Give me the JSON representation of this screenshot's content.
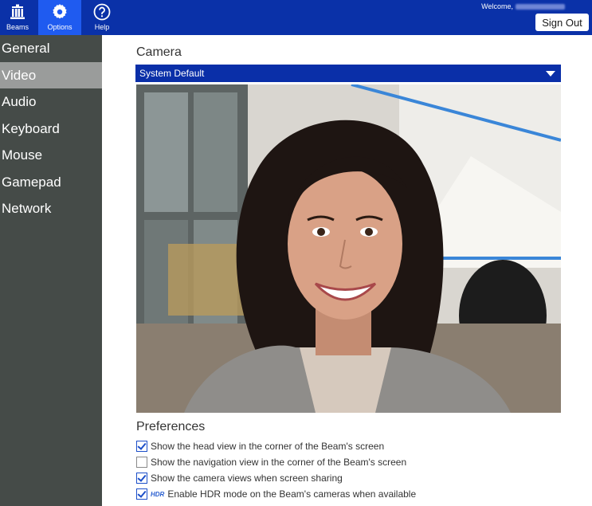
{
  "topbar": {
    "nav": [
      {
        "label": "Beams",
        "icon": "building-icon"
      },
      {
        "label": "Options",
        "icon": "gear-icon",
        "active": true
      },
      {
        "label": "Help",
        "icon": "question-icon"
      }
    ],
    "welcome_prefix": "Welcome,",
    "sign_out": "Sign Out",
    "colors": {
      "bar": "#0a31a8",
      "active_tab": "#1f5bf0"
    }
  },
  "sidebar": {
    "items": [
      {
        "label": "General"
      },
      {
        "label": "Video",
        "active": true
      },
      {
        "label": "Audio"
      },
      {
        "label": "Keyboard"
      },
      {
        "label": "Mouse"
      },
      {
        "label": "Gamepad"
      },
      {
        "label": "Network"
      }
    ]
  },
  "camera": {
    "title": "Camera",
    "selected": "System Default"
  },
  "preferences": {
    "title": "Preferences",
    "items": [
      {
        "label": "Show the head view in the corner of the Beam's screen",
        "checked": true
      },
      {
        "label": "Show the navigation view in the corner of the Beam's screen",
        "checked": false
      },
      {
        "label": "Show the camera views when screen sharing",
        "checked": true
      },
      {
        "label": "Enable HDR mode on the Beam's cameras when available",
        "checked": true,
        "badge": "HDR"
      }
    ]
  }
}
